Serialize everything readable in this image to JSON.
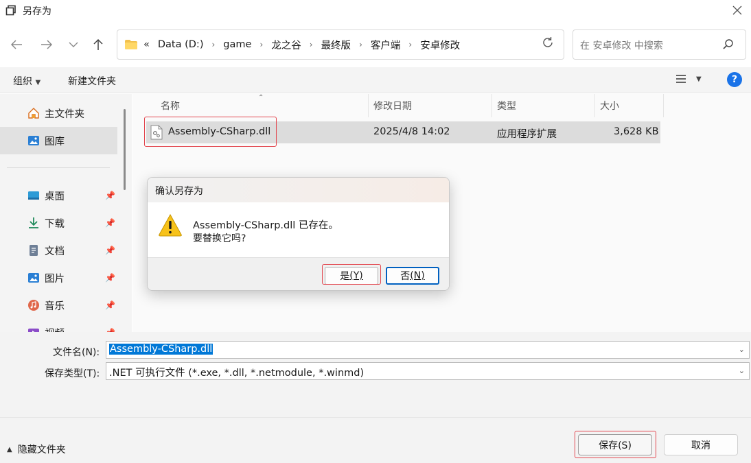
{
  "window": {
    "title": "另存为"
  },
  "address": {
    "overflow": "«",
    "crumbs": [
      "Data (D:)",
      "game",
      "龙之谷",
      "最终版",
      "客户端",
      "安卓修改"
    ],
    "search_placeholder": "在 安卓修改 中搜索"
  },
  "commandbar": {
    "organize": "组织",
    "new_folder": "新建文件夹"
  },
  "sidebar": {
    "items": [
      {
        "label": "主文件夹",
        "icon": "home-icon"
      },
      {
        "label": "图库",
        "icon": "gallery-icon"
      },
      {
        "label": "桌面",
        "icon": "desktop-icon"
      },
      {
        "label": "下载",
        "icon": "download-icon"
      },
      {
        "label": "文档",
        "icon": "document-icon"
      },
      {
        "label": "图片",
        "icon": "pictures-icon"
      },
      {
        "label": "音乐",
        "icon": "music-icon"
      },
      {
        "label": "视频",
        "icon": "video-icon"
      }
    ]
  },
  "columns": {
    "name": "名称",
    "modified": "修改日期",
    "type": "类型",
    "size": "大小"
  },
  "files": [
    {
      "name": "Assembly-CSharp.dll",
      "modified": "2025/4/8 14:02",
      "type": "应用程序扩展",
      "size": "3,628 KB"
    }
  ],
  "dialog": {
    "title": "确认另存为",
    "message_line1": "Assembly-CSharp.dll 已存在。",
    "message_line2": "要替换它吗?",
    "yes_label": "是",
    "yes_key": "(Y)",
    "no_label": "否",
    "no_key": "(N)"
  },
  "form": {
    "filename_label": "文件名(N):",
    "filename_value": "Assembly-CSharp.dll",
    "filetype_label": "保存类型(T):",
    "filetype_value": ".NET 可执行文件 (*.exe, *.dll, *.netmodule, *.winmd)"
  },
  "footer": {
    "hide_folders": "隐藏文件夹",
    "save": "保存(S)",
    "cancel": "取消"
  },
  "colors": {
    "accent": "#0078d7",
    "highlight_box": "#e2454d",
    "help": "#1a73e8"
  }
}
